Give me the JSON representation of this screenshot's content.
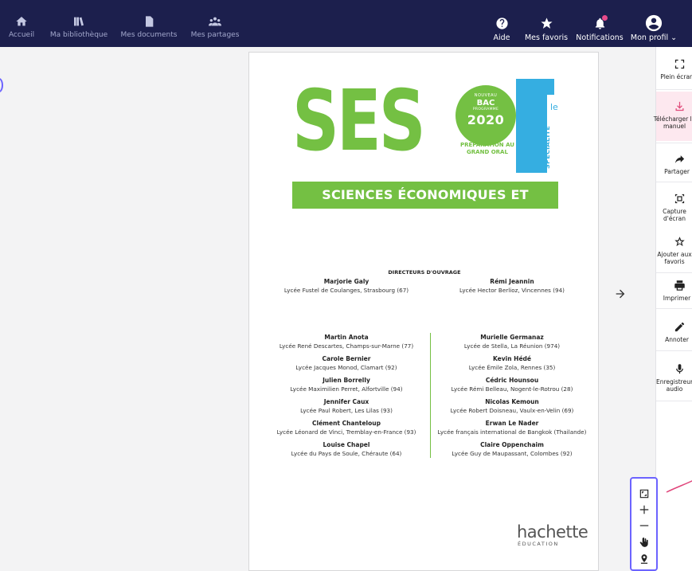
{
  "topbar": {
    "left_items": [
      {
        "label": "Accueil",
        "icon": "home-icon"
      },
      {
        "label": "Ma bibliothèque",
        "icon": "library-icon"
      },
      {
        "label": "Mes documents",
        "icon": "document-icon"
      },
      {
        "label": "Mes partages",
        "icon": "shares-icon"
      }
    ],
    "right_items": [
      {
        "label": "Aide",
        "icon": "help-icon"
      },
      {
        "label": "Mes favoris",
        "icon": "star-icon"
      },
      {
        "label": "Notifications",
        "icon": "bell-icon"
      },
      {
        "label": "Mon profil",
        "icon": "user-icon"
      }
    ],
    "colors": {
      "background": "#1c1f4d",
      "notification_dot": "#e84a8a"
    }
  },
  "page": {
    "cover": {
      "title": "SES",
      "badge_nouveau": "NOUVEAU",
      "badge_bac": "BAC",
      "badge_programme": "PROGRAMME",
      "badge_year": "2020",
      "preparation": "PRÉPARATION AU GRAND ORAL",
      "t_letter": "T",
      "t_suffix": "le",
      "specialite": "SPÉCIALITÉ",
      "subtitle": "SCIENCES ÉCONOMIQUES ET SOCIALES",
      "colors": {
        "green": "#74c043",
        "blue": "#35aee1"
      }
    },
    "directors_title": "DIRECTEURS D'OUVRAGE",
    "directors": [
      {
        "name": "Marjorie Galy",
        "school": "Lycée Fustel de Coulanges, Strasbourg (67)"
      },
      {
        "name": "Rémi Jeannin",
        "school": "Lycée Hector Berlioz, Vincennes (94)"
      }
    ],
    "authors_left": [
      {
        "name": "Martin Anota",
        "school": "Lycée René Descartes, Champs-sur-Marne (77)"
      },
      {
        "name": "Carole Bernier",
        "school": "Lycée Jacques Monod, Clamart (92)"
      },
      {
        "name": "Julien Borrelly",
        "school": "Lycée Maximilien Perret, Alfortville (94)"
      },
      {
        "name": "Jennifer Caux",
        "school": "Lycée Paul Robert, Les Lilas (93)"
      },
      {
        "name": "Clément Chanteloup",
        "school": "Lycée Léonard de Vinci, Tremblay-en-France (93)"
      },
      {
        "name": "Louise Chapel",
        "school": "Lycée du Pays de Soule, Chéraute (64)"
      }
    ],
    "authors_right": [
      {
        "name": "Murielle Germanaz",
        "school": "Lycée de Stella, La Réunion (974)"
      },
      {
        "name": "Kevin Hédé",
        "school": "Lycée Émile Zola, Rennes (35)"
      },
      {
        "name": "Cédric Hounsou",
        "school": "Lycée Rémi Belleau, Nogent-le-Rotrou (28)"
      },
      {
        "name": "Nicolas Kemoun",
        "school": "Lycée Robert Doisneau, Vaulx-en-Velin (69)"
      },
      {
        "name": "Erwan Le Nader",
        "school": "Lycée français international de Bangkok (Thailande)"
      },
      {
        "name": "Claire Oppenchaim",
        "school": "Lycée Guy de Maupassant, Colombes (92)"
      }
    ],
    "publisher": "hachette",
    "publisher_sub": "ÉDUCATION"
  },
  "toolbar": {
    "items": [
      {
        "label": "Plein écran",
        "icon": "fullscreen-icon"
      },
      {
        "label": "Télécharger le manuel",
        "icon": "download-icon"
      },
      {
        "label": "Partager",
        "icon": "share-icon"
      },
      {
        "label": "Capture d'écran",
        "icon": "screenshot-icon"
      },
      {
        "label": "Ajouter aux favoris",
        "icon": "star-outline-icon"
      },
      {
        "label": "Imprimer",
        "icon": "print-icon"
      },
      {
        "label": "Annoter",
        "icon": "pencil-icon"
      },
      {
        "label": "Enregistreur audio",
        "icon": "microphone-icon"
      }
    ],
    "highlight_color": "#fde8ef"
  },
  "zoom": {
    "buttons": [
      "fit-page-icon",
      "zoom-in-icon",
      "zoom-out-icon",
      "pan-hand-icon",
      "location-pin-icon"
    ],
    "accent": "#6c63ff"
  }
}
